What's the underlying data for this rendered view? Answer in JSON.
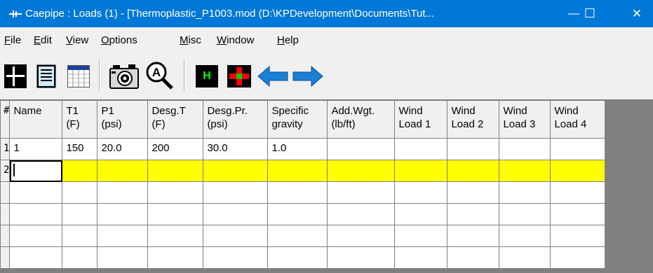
{
  "window": {
    "title": "Caepipe : Loads  (1)  -  [Thermoplastic_P1003.mod (D:\\KPDevelopment\\Documents\\Tut...",
    "minimize": "—",
    "maximize": "☐",
    "close": "✕",
    "accent": "#0078d7"
  },
  "menu": {
    "file": {
      "key": "F",
      "rest": "ile"
    },
    "edit": {
      "key": "E",
      "rest": "dit"
    },
    "view": {
      "key": "V",
      "rest": "iew"
    },
    "options": {
      "key": "O",
      "rest": "ptions"
    },
    "misc": {
      "key": "M",
      "rest": "isc"
    },
    "window": {
      "key": "W",
      "rest": "indow"
    },
    "help": {
      "key": "H",
      "rest": "elp"
    }
  },
  "toolbar": {
    "icons": [
      "grid-icon",
      "list-icon",
      "table-icon",
      "camera-icon",
      "zoom-icon",
      "h-icon",
      "cross-icon",
      "arrow-left-icon",
      "arrow-right-icon"
    ],
    "h_label": "H"
  },
  "grid": {
    "headers": [
      {
        "l1": "#",
        "l2": ""
      },
      {
        "l1": "Name",
        "l2": ""
      },
      {
        "l1": "T1",
        "l2": "(F)"
      },
      {
        "l1": "P1",
        "l2": "(psi)"
      },
      {
        "l1": "Desg.T",
        "l2": "(F)"
      },
      {
        "l1": "Desg.Pr.",
        "l2": "(psi)"
      },
      {
        "l1": "Specific",
        "l2": "gravity"
      },
      {
        "l1": "Add.Wgt.",
        "l2": "(lb/ft)"
      },
      {
        "l1": "Wind",
        "l2": "Load 1"
      },
      {
        "l1": "Wind",
        "l2": "Load 2"
      },
      {
        "l1": "Wind",
        "l2": "Load 3"
      },
      {
        "l1": "Wind",
        "l2": "Load 4"
      }
    ],
    "rows": [
      [
        "1",
        "1",
        "150",
        "20.0",
        "200",
        "30.0",
        "1.0",
        "",
        "",
        "",
        "",
        ""
      ],
      [
        "2",
        "",
        "",
        "",
        "",
        "",
        "",
        "",
        "",
        "",
        "",
        ""
      ],
      [
        "",
        "",
        "",
        "",
        "",
        "",
        "",
        "",
        "",
        "",
        "",
        ""
      ],
      [
        "",
        "",
        "",
        "",
        "",
        "",
        "",
        "",
        "",
        "",
        "",
        ""
      ],
      [
        "",
        "",
        "",
        "",
        "",
        "",
        "",
        "",
        "",
        "",
        "",
        ""
      ],
      [
        "",
        "",
        "",
        "",
        "",
        "",
        "",
        "",
        "",
        "",
        "",
        ""
      ]
    ],
    "selected_row_color": "#ffff00"
  }
}
